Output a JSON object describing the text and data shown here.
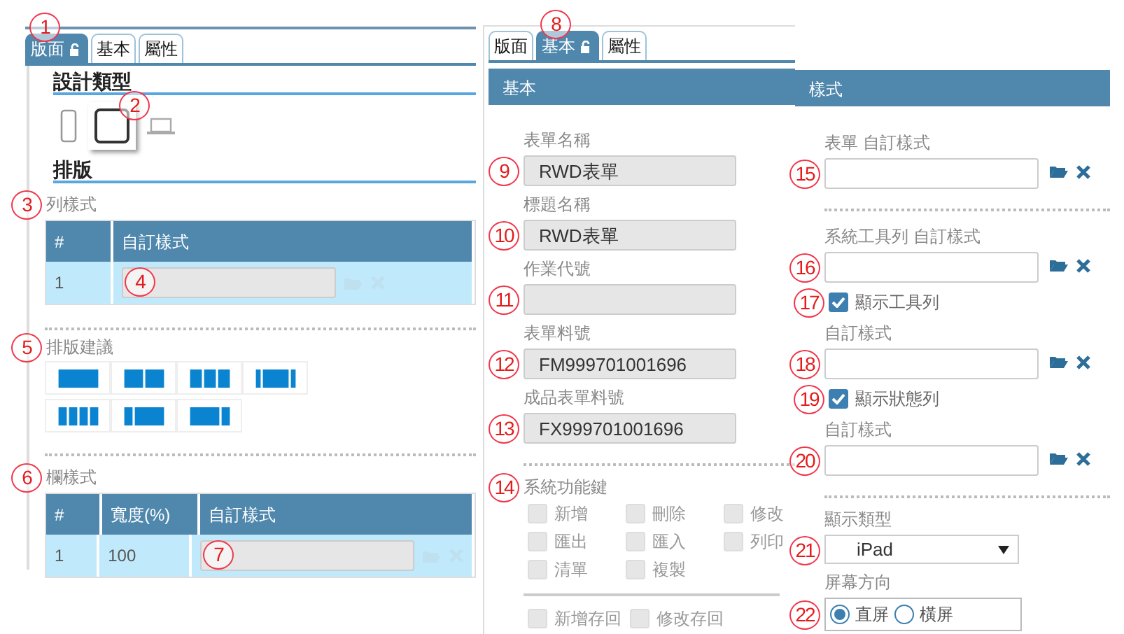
{
  "layout_panel": {
    "tabs": [
      {
        "label": "版面",
        "selected": true,
        "callout": "1"
      },
      {
        "label": "基本",
        "selected": false
      },
      {
        "label": "屬性",
        "selected": false
      }
    ],
    "design_type": {
      "title": "設計類型",
      "devices": [
        {
          "kind": "phone",
          "selected": false
        },
        {
          "kind": "tablet",
          "selected": true,
          "callout": "2"
        },
        {
          "kind": "laptop",
          "selected": false
        }
      ]
    },
    "layout_title": "排版",
    "row_style": {
      "label": "列樣式",
      "callout": "3",
      "columns": [
        "#",
        "自訂樣式"
      ],
      "rows": [
        {
          "cells": [
            "1"
          ],
          "style_field": {
            "disabled": true,
            "callout": "4"
          }
        }
      ]
    },
    "layout_suggestions": {
      "label": "排版建議",
      "callout": "5",
      "options": [
        {
          "kind": "full"
        },
        {
          "kind": "halves"
        },
        {
          "kind": "thirds"
        },
        {
          "kind": "narrow-wide-narrow"
        },
        {
          "kind": "quarters"
        },
        {
          "kind": "narrow-wide"
        },
        {
          "kind": "wide-narrow"
        }
      ]
    },
    "column_style": {
      "label": "欄樣式",
      "callout": "6",
      "columns": [
        "#",
        "寬度(%)",
        "自訂樣式"
      ],
      "rows": [
        {
          "cells": [
            "1",
            "100"
          ],
          "style_field": {
            "disabled": true,
            "callout": "7"
          }
        }
      ]
    }
  },
  "basic_panel": {
    "tabs": [
      {
        "label": "版面",
        "selected": false
      },
      {
        "label": "基本",
        "selected": true,
        "callout": "8"
      },
      {
        "label": "屬性",
        "selected": false
      }
    ],
    "header": "基本",
    "fields": [
      {
        "label": "表單名稱",
        "value": "RWD表單",
        "disabled": true,
        "callout": "9"
      },
      {
        "label": "標題名稱",
        "value": "RWD表單",
        "disabled": true,
        "callout": "10"
      },
      {
        "label": "作業代號",
        "disabled": true,
        "callout": "11"
      },
      {
        "label": "表單料號",
        "value": "FM999701001696",
        "disabled": true,
        "callout": "12"
      },
      {
        "label": "成品表單料號",
        "value": "FX999701001696",
        "disabled": true,
        "callout": "13"
      }
    ],
    "function_keys": {
      "label": "系統功能鍵",
      "callout": "14",
      "options": [
        {
          "label": "新增",
          "checked": false,
          "disabled": true
        },
        {
          "label": "刪除",
          "checked": false,
          "disabled": true
        },
        {
          "label": "修改",
          "checked": false,
          "disabled": true
        },
        {
          "label": "匯出",
          "checked": false,
          "disabled": true
        },
        {
          "label": "匯入",
          "checked": false,
          "disabled": true
        },
        {
          "label": "列印",
          "checked": false,
          "disabled": true
        },
        {
          "label": "清單",
          "checked": false,
          "disabled": true
        },
        {
          "label": "複製",
          "checked": false,
          "disabled": true
        }
      ],
      "save_options": [
        {
          "label": "新增存回",
          "checked": false,
          "disabled": true
        },
        {
          "label": "修改存回",
          "checked": false,
          "disabled": true
        }
      ]
    }
  },
  "style_panel": {
    "header": "樣式",
    "groups": [
      {
        "items": [
          {
            "kind": "field",
            "label": "表單 自訂樣式",
            "callout": "15"
          }
        ]
      },
      {
        "items": [
          {
            "kind": "field",
            "label": "系統工具列 自訂樣式",
            "callout": "16"
          },
          {
            "kind": "checkbox",
            "label": "顯示工具列",
            "checked": true,
            "callout": "17"
          },
          {
            "kind": "field",
            "label": "自訂樣式",
            "callout": "18"
          },
          {
            "kind": "checkbox",
            "label": "顯示狀態列",
            "checked": true,
            "callout": "19"
          },
          {
            "kind": "field",
            "label": "自訂樣式",
            "callout": "20"
          }
        ]
      }
    ],
    "display_type": {
      "label": "顯示類型",
      "value": "iPad",
      "callout": "21"
    },
    "orientation": {
      "label": "屏幕方向",
      "callout": "22",
      "options": [
        {
          "label": "直屏",
          "selected": true
        },
        {
          "label": "橫屏",
          "selected": false
        }
      ]
    }
  }
}
